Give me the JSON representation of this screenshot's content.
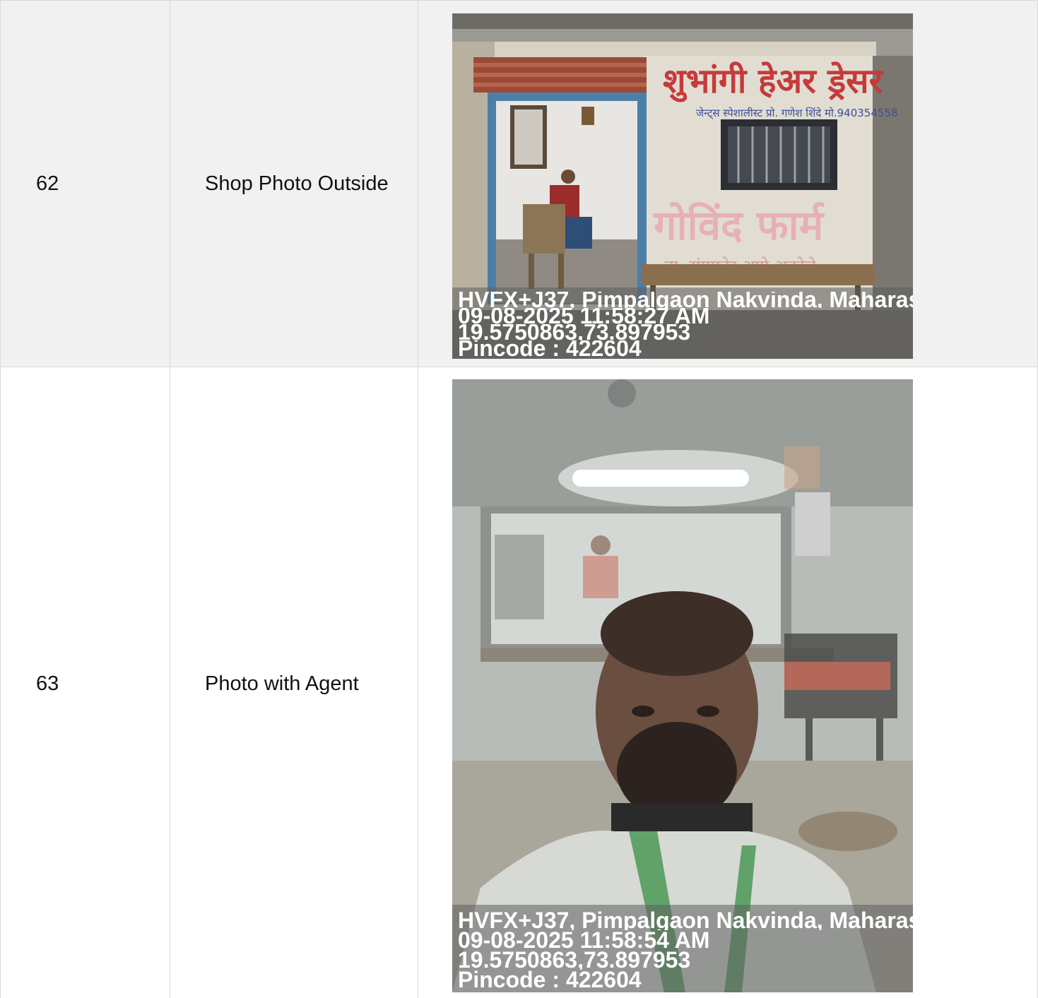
{
  "rows": [
    {
      "sno": "62",
      "label": "Shop Photo Outside",
      "photo": {
        "subject": "shop-front-photo",
        "sign_text": "शुभांगी हेअर ड्रेसर",
        "sign_subtext": "जेन्ट्स स्पेशालीस्ट प्रो. गणेश शिंदे मो.940354558",
        "wall_text": "गोविंद फार्म",
        "wall_text_2": "ता. संगमनेर आगे अकोले",
        "stamp": [
          "HVFX+J37, Pimpalgaon Nakvinda, Maharash",
          "09-08-2025 11:58:27 AM",
          "19.5750863,73.897953",
          "Pincode : 422604"
        ]
      }
    },
    {
      "sno": "63",
      "label": "Photo with Agent",
      "photo": {
        "subject": "agent-selfie-photo",
        "stamp": [
          "HVFX+J37, Pimpalgaon Nakvinda, Maharash",
          "09-08-2025 11:58:54 AM",
          "19.5750863,73.897953",
          "Pincode : 422604"
        ]
      }
    }
  ]
}
